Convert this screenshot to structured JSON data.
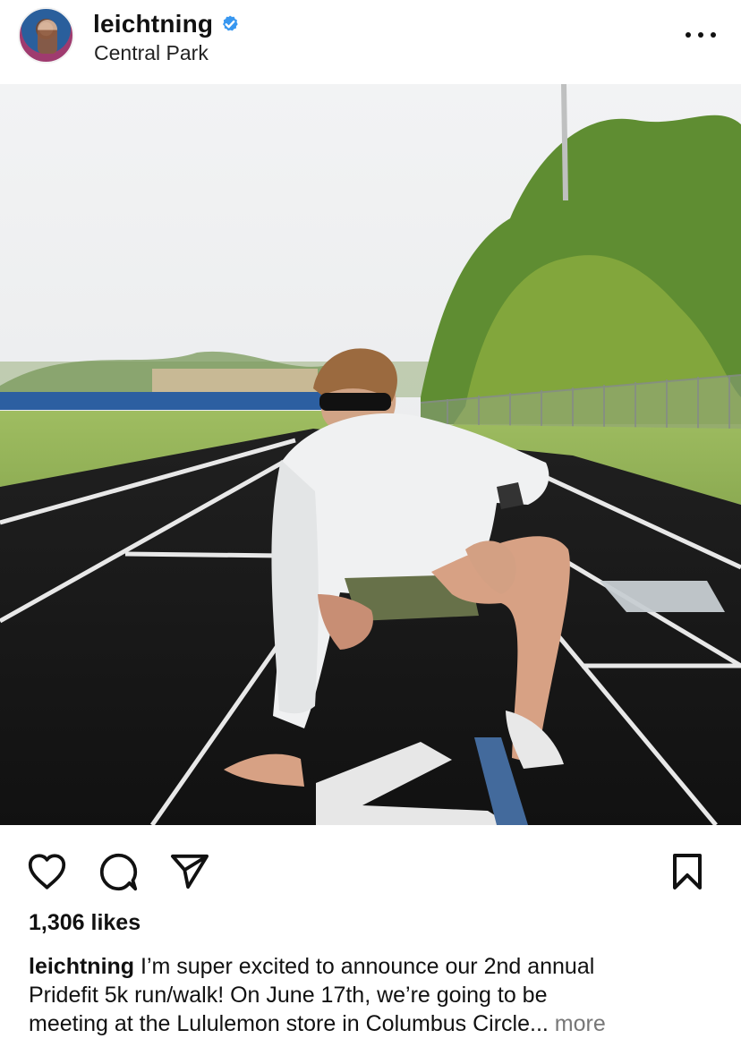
{
  "post": {
    "username": "leichtning",
    "location": "Central Park",
    "likes": "1,306 likes",
    "caption_user": "leichtning",
    "caption_line1": " I’m super excited to announce our 2nd annual",
    "caption_line2": "Pridefit 5k run/walk! On June 17th, we’re going to be",
    "caption_line3": "meeting at the Lululemon store in Columbus Circle",
    "caption_ellipsis": "...",
    "more_label": " more"
  },
  "icons": {
    "avatar": "profile-avatar",
    "verified": "verified-badge-icon",
    "menu": "more-options-icon",
    "calendar": "calendar-icon",
    "like": "heart-icon",
    "comment": "comment-icon",
    "share": "send-icon",
    "save": "bookmark-icon"
  },
  "colors": {
    "verified": "#3897f0",
    "text": "#111111",
    "muted": "#777777"
  }
}
